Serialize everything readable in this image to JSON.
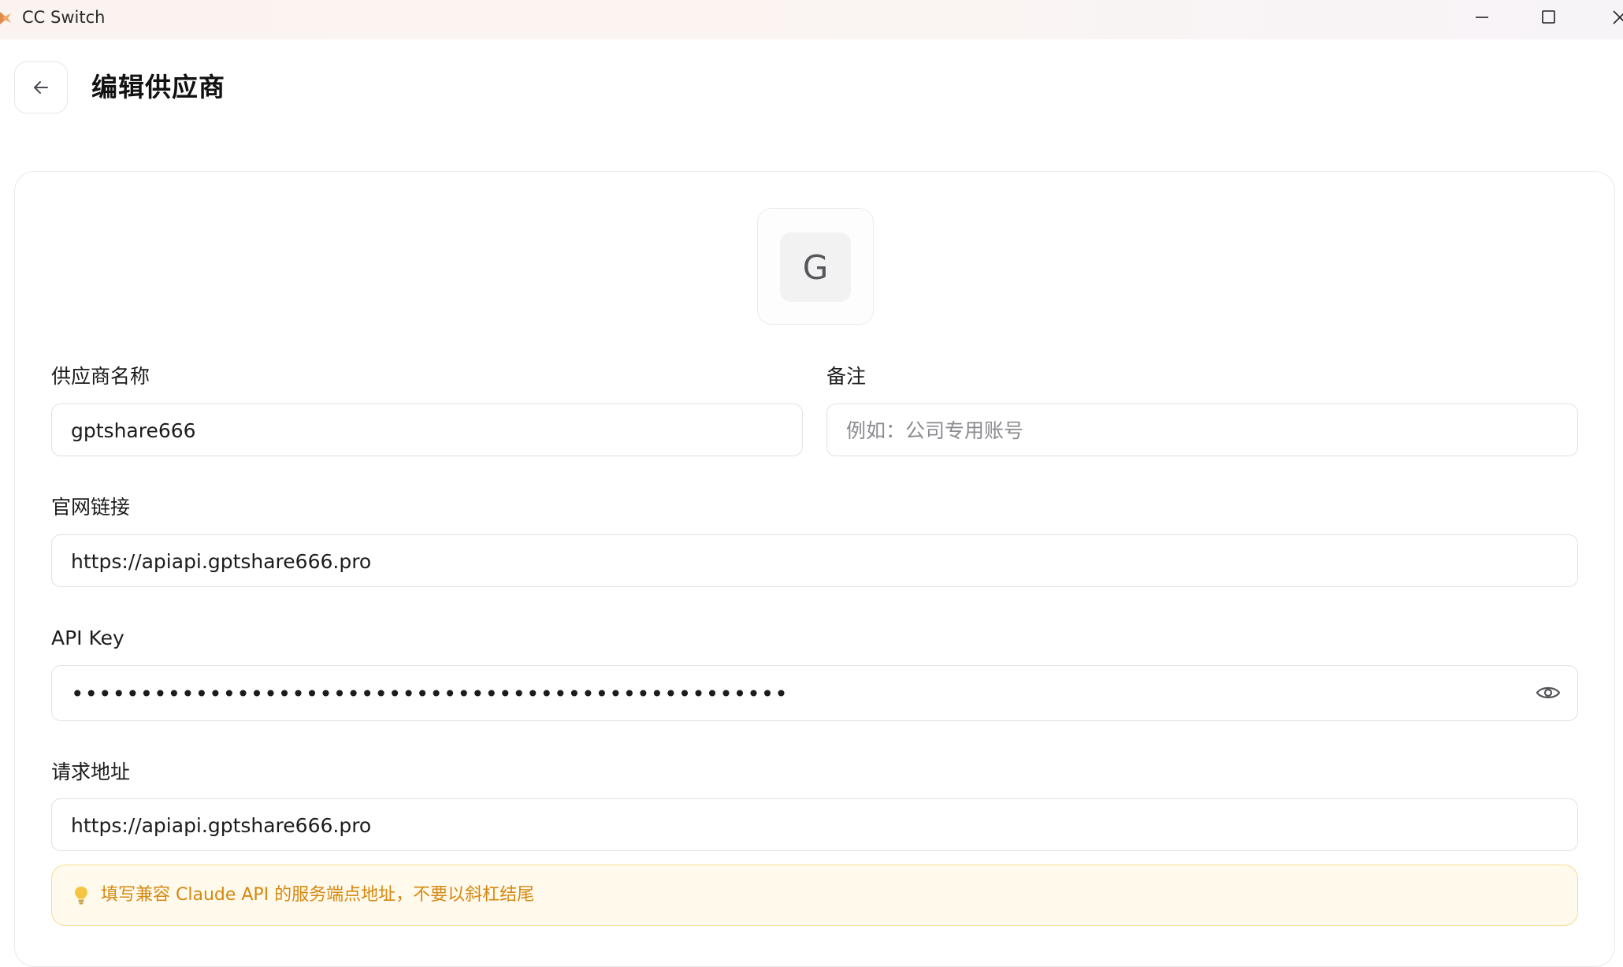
{
  "window": {
    "title": "CC Switch",
    "app_icon": "cc-switch-logo",
    "controls": [
      "minimize-icon",
      "maximize-icon",
      "close-icon"
    ]
  },
  "header": {
    "back_icon": "arrow-left-icon",
    "title": "编辑供应商"
  },
  "provider": {
    "avatar_letter": "G"
  },
  "form": {
    "name": {
      "label": "供应商名称",
      "value": "gptshare666"
    },
    "notes": {
      "label": "备注",
      "value": "",
      "placeholder": "例如：公司专用账号"
    },
    "website": {
      "label": "官网链接",
      "value": "https://apiapi.gptshare666.pro"
    },
    "api_key": {
      "label": "API Key",
      "masked_value": "••••••••••••••••••••••••••••••••••••••••••••••••••••",
      "toggle_icon": "eye-icon"
    },
    "endpoint": {
      "label": "请求地址",
      "value": "https://apiapi.gptshare666.pro"
    }
  },
  "hint": {
    "icon": "lightbulb-icon",
    "text": "填写兼容 Claude API 的服务端点地址，不要以斜杠结尾"
  },
  "colors": {
    "hint_text": "#d68812",
    "hint_bg": "#fffaeb",
    "hint_border": "#f4dd95",
    "border": "#e2e2e6"
  }
}
